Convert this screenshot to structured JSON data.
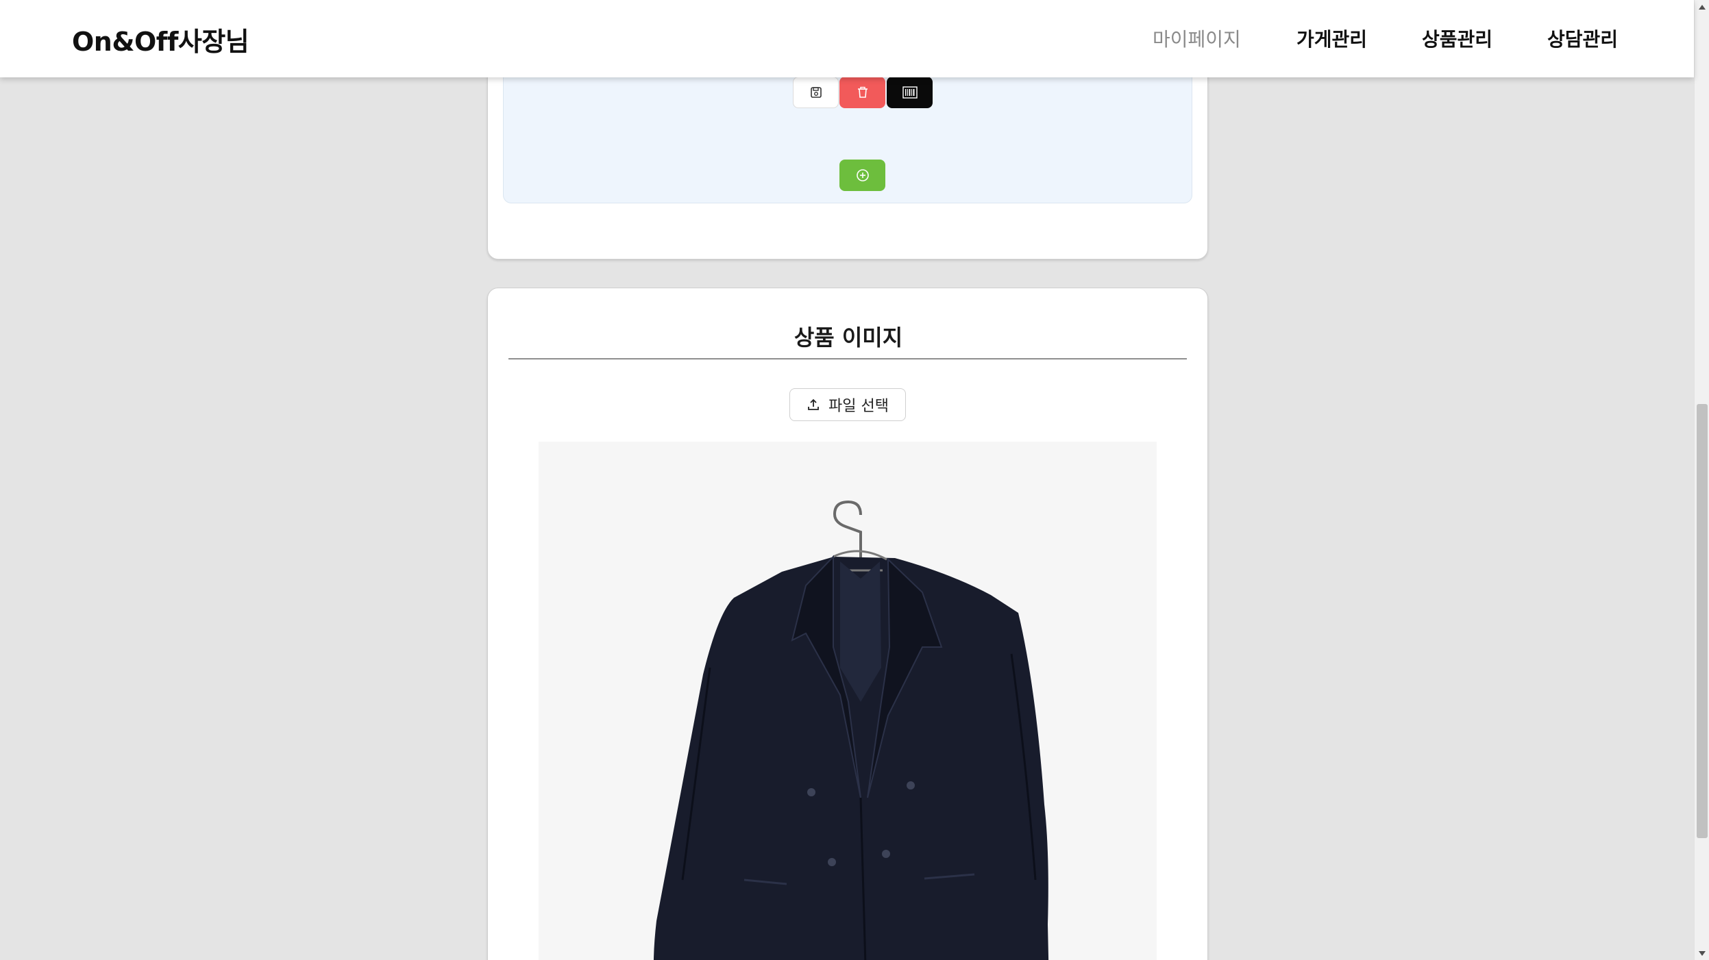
{
  "header": {
    "brand": "On&Off사장님",
    "nav": [
      "마이페이지",
      "가게관리",
      "상품관리",
      "상담관리"
    ]
  },
  "option_panel": {
    "buttons": {
      "save_icon": "save-icon",
      "delete_icon": "trash-icon",
      "barcode_icon": "barcode-icon",
      "add_icon": "plus-circle-icon"
    }
  },
  "image_section": {
    "title": "상품 이미지",
    "upload_label": "파일 선택",
    "upload_icon": "upload-icon",
    "image_alt": "navy double-breasted blazer on hanger"
  },
  "colors": {
    "delete": "#f25a5a",
    "add": "#6dbe3d",
    "barcode": "#0a0a0a",
    "panel": "#eef5fd"
  }
}
